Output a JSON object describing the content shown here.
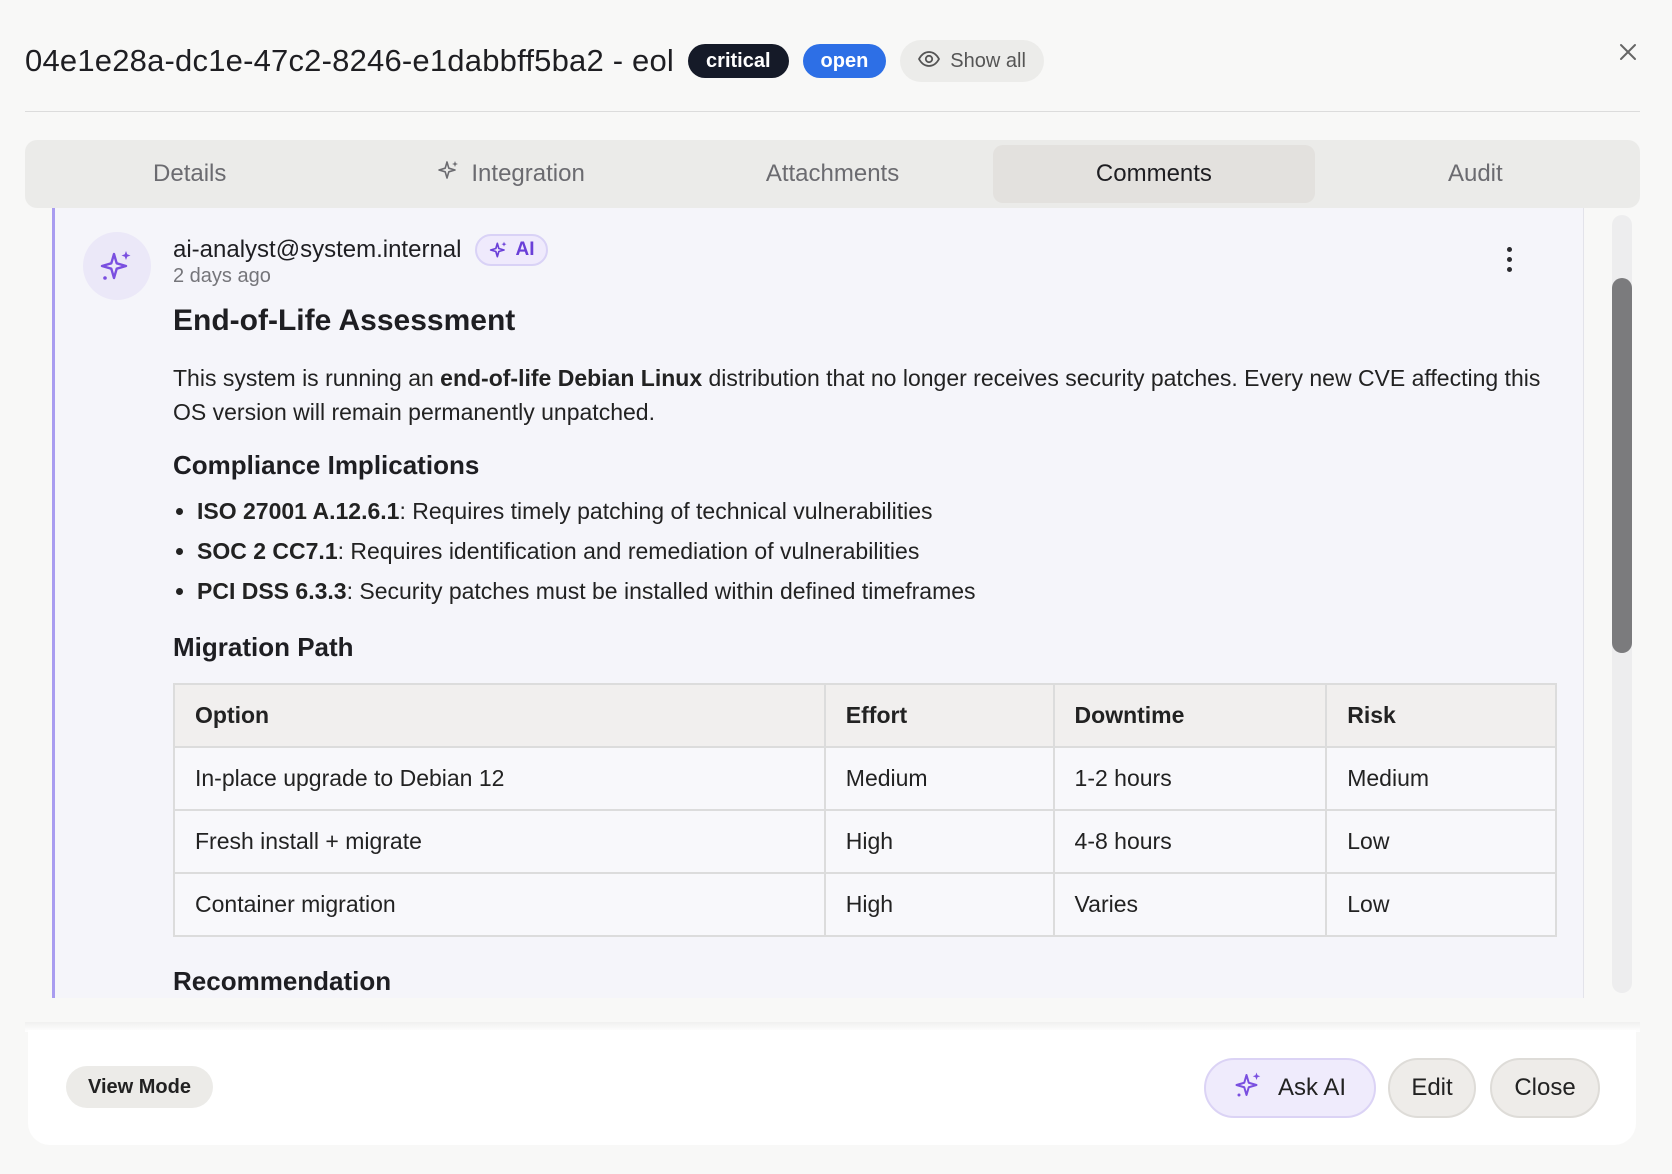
{
  "header": {
    "title": "04e1e28a-dc1e-47c2-8246-e1dabbff5ba2 - eol",
    "severity_badge": "critical",
    "status_badge": "open",
    "show_all_label": "Show all"
  },
  "tabs": [
    {
      "label": "Details"
    },
    {
      "label": "Integration"
    },
    {
      "label": "Attachments"
    },
    {
      "label": "Comments",
      "active": true
    },
    {
      "label": "Audit"
    }
  ],
  "comment": {
    "author": "ai-analyst@system.internal",
    "ai_badge": "AI",
    "time": "2 days ago",
    "heading": "End-of-Life Assessment",
    "intro_before": "This system is running an ",
    "intro_bold": "end-of-life Debian Linux",
    "intro_after": " distribution that no longer receives security patches. Every new CVE affecting this OS version will remain permanently unpatched.",
    "compliance_heading": "Compliance Implications",
    "compliance": [
      {
        "code": "ISO 27001 A.12.6.1",
        "text": ": Requires timely patching of technical vulnerabilities"
      },
      {
        "code": "SOC 2 CC7.1",
        "text": ": Requires identification and remediation of vulnerabilities"
      },
      {
        "code": "PCI DSS 6.3.3",
        "text": ": Security patches must be installed within defined timeframes"
      }
    ],
    "migration_heading": "Migration Path",
    "table": {
      "headers": [
        "Option",
        "Effort",
        "Downtime",
        "Risk"
      ],
      "rows": [
        [
          "In-place upgrade to Debian 12",
          "Medium",
          "1-2 hours",
          "Medium"
        ],
        [
          "Fresh install + migrate",
          "High",
          "4-8 hours",
          "Low"
        ],
        [
          "Container migration",
          "High",
          "Varies",
          "Low"
        ]
      ]
    },
    "recommendation_heading": "Recommendation"
  },
  "footer": {
    "view_mode_label": "View Mode",
    "ask_ai_label": "Ask AI",
    "edit_label": "Edit",
    "close_label": "Close"
  },
  "colors": {
    "critical": "#151a28",
    "open": "#2d6fe6",
    "ai_accent": "#6a3fd8"
  }
}
